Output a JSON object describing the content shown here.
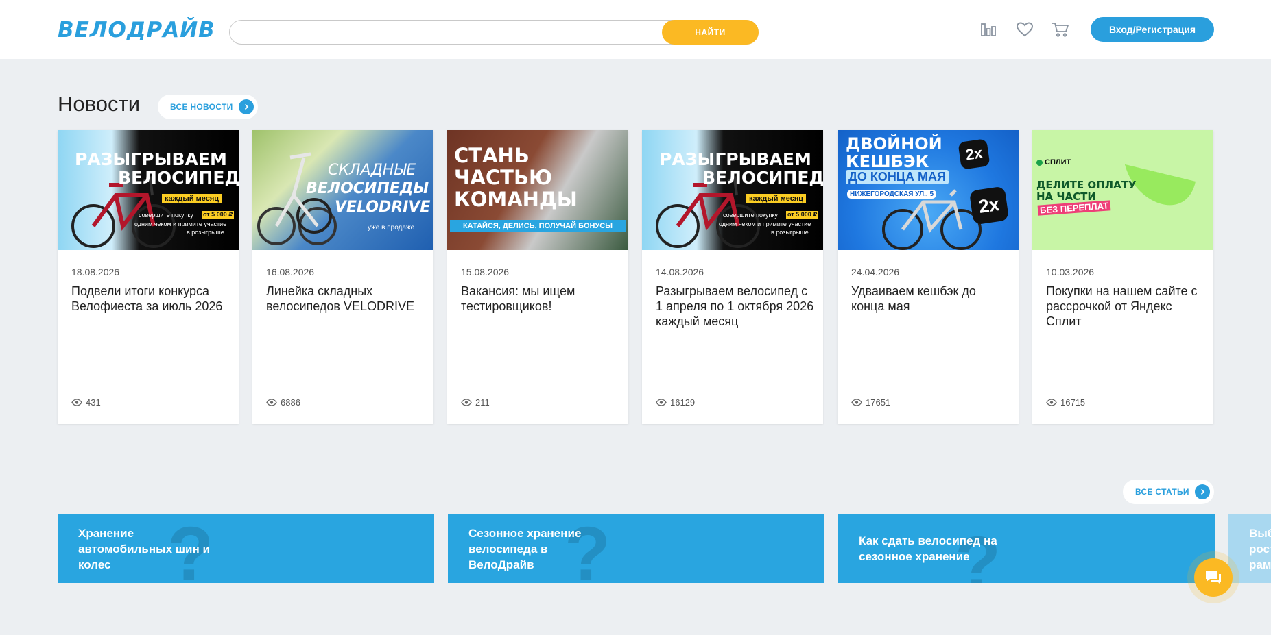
{
  "header": {
    "logo": "ВЕЛОДРАЙВ",
    "search": {
      "value": "",
      "placeholder": ""
    },
    "search_button": "НАЙТИ",
    "icons": [
      "compare-icon",
      "heart-icon",
      "cart-icon"
    ],
    "login_button": "Вход/Регистрация"
  },
  "news": {
    "title": "Новости",
    "all_link": "ВСЕ НОВОСТИ",
    "cards": [
      {
        "date": "18.08.2026",
        "title": "Подвели итоги конкурса Велофиеста за июль 2026",
        "views": "431",
        "banner": {
          "line1": "РАЗЫГРЫВАЕМ",
          "line2": "ВЕЛОСИПЕД!",
          "tag": "каждый месяц",
          "small1": "совершите покупку",
          "chip": "от 5 000 ₽",
          "small2": "одним чеком и примите участие",
          "small3": "в розыгрыше"
        }
      },
      {
        "date": "16.08.2026",
        "title": "Линейка складных велосипедов VELODRIVE",
        "views": "6886",
        "banner": {
          "line1": "СКЛАДНЫЕ",
          "line2": "ВЕЛОСИПЕДЫ",
          "line3": "VELODRIVE",
          "small": "уже в продаже"
        }
      },
      {
        "date": "15.08.2026",
        "title": "Вакансия: мы ищем тестировщиков!",
        "views": "211",
        "banner": {
          "line1": "СТАНЬ",
          "line2": "ЧАСТЬЮ",
          "line3": "КОМАНДЫ",
          "strip": "КАТАЙСЯ, ДЕЛИСЬ, ПОЛУЧАЙ БОНУСЫ"
        }
      },
      {
        "date": "14.08.2026",
        "title": "Разыгрываем велосипед с 1 апреля по 1 октября 2026 каждый месяц",
        "views": "16129",
        "banner": {
          "line1": "РАЗЫГРЫВАЕМ",
          "line2": "ВЕЛОСИПЕД!",
          "tag": "каждый месяц",
          "small1": "совершите покупку",
          "chip": "от 5 000 ₽",
          "small2": "одним чеком и примите участие",
          "small3": "в розыгрыше"
        }
      },
      {
        "date": "24.04.2026",
        "title": "Удваиваем кешбэк до конца мая",
        "views": "17651",
        "banner": {
          "line1": "ДВОЙНОЙ",
          "line2": "КЕШБЭК",
          "line3": "ДО КОНЦА МАЯ",
          "address": "НИЖЕГОРОДСКАЯ УЛ., 5",
          "badge": "2x"
        }
      },
      {
        "date": "10.03.2026",
        "title": "Покупки на нашем сайте с рассрочкой от Яндекс Сплит",
        "views": "16715",
        "banner": {
          "brand": "СПЛИТ",
          "line1": "ДЕЛИТЕ ОПЛАТУ",
          "line2": "НА ЧАСТИ",
          "tag": "БЕЗ ПЕРЕПЛАТ"
        }
      }
    ]
  },
  "articles": {
    "all_link": "ВСЕ СТАТЬИ",
    "items": [
      {
        "title_lines": [
          "Хранение",
          "автомобильных шин и",
          "колес"
        ]
      },
      {
        "title_lines": [
          "Сезонное хранение",
          "велосипеда в",
          "ВелоДрайв"
        ]
      },
      {
        "title_lines": [
          "Как сдать велосипед на",
          "сезонное хранение"
        ]
      },
      {
        "title_lines": [
          "Выб",
          "рост",
          "рам"
        ]
      }
    ]
  },
  "colors": {
    "brand_blue": "#2a9fdd",
    "accent_yellow": "#fbb923",
    "article_blue": "#29a5e0",
    "page_bg": "#eceff2"
  }
}
